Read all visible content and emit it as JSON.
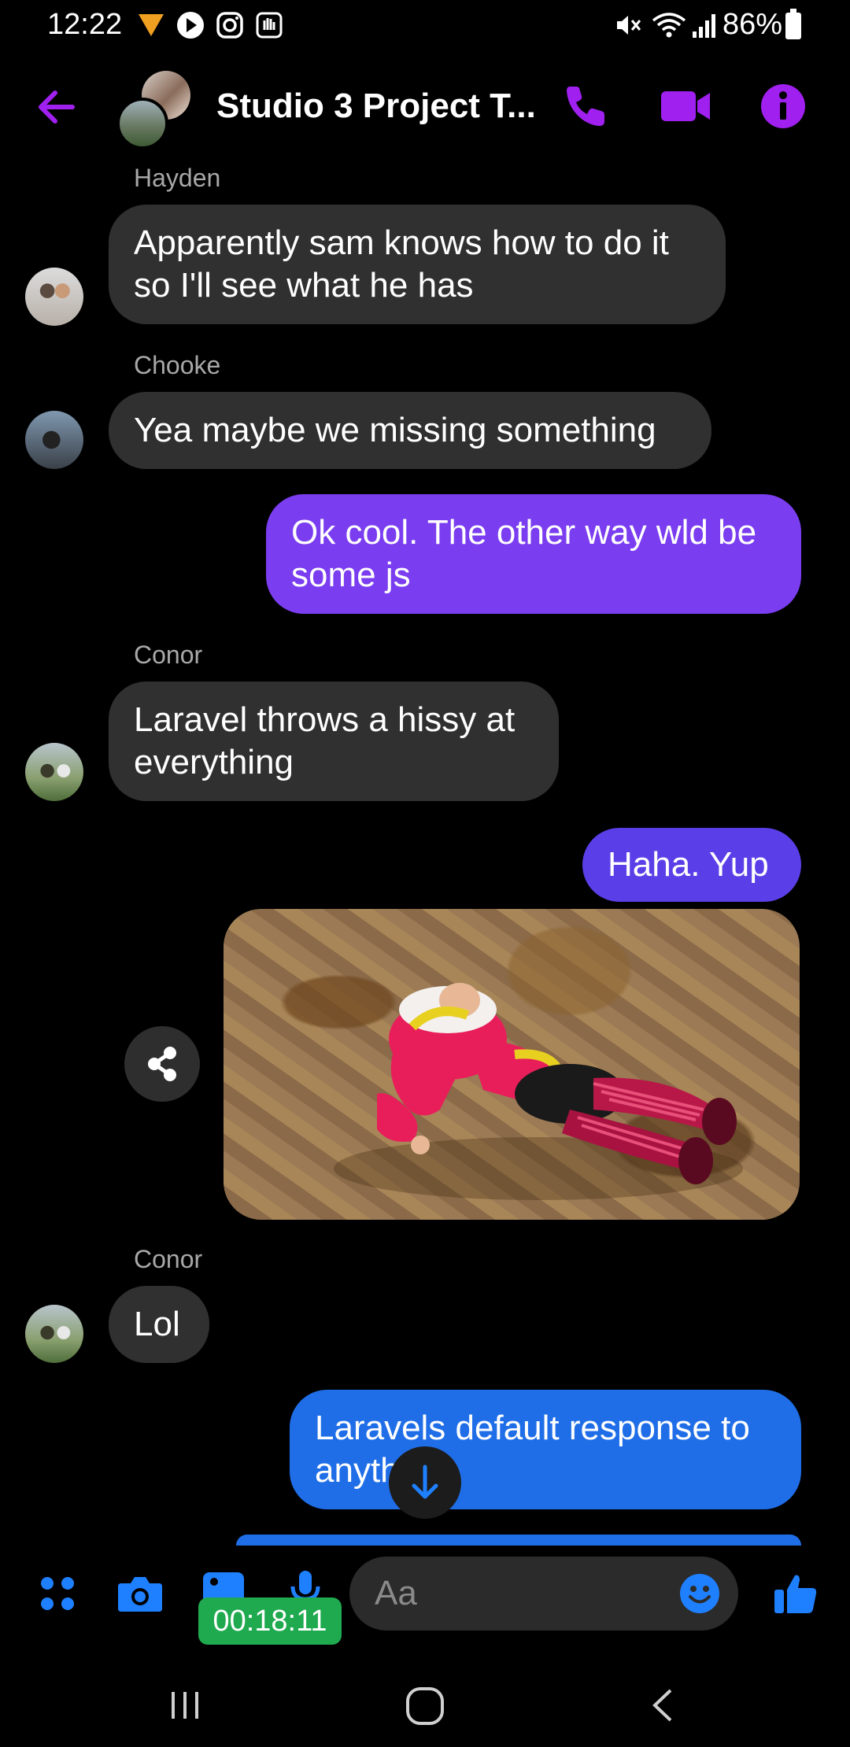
{
  "status_bar": {
    "time": "12:22",
    "battery": "86%"
  },
  "header": {
    "title": "Studio 3 Project T...",
    "accent": "#a020f0"
  },
  "messages": [
    {
      "sender": "Hayden",
      "text_lines": [
        "Apparently sam knows how to do it",
        "so I'll see what he has"
      ]
    },
    {
      "sender": "Chooke",
      "text_lines": [
        "Yea maybe we missing something"
      ]
    },
    {
      "sender": "me",
      "text_lines": [
        "Ok cool. The other way wld be",
        "some js"
      ]
    },
    {
      "sender": "Conor",
      "text_lines": [
        "Laravel throws a hissy at",
        "everything"
      ]
    },
    {
      "sender": "me",
      "text_lines": [
        "Haha. Yup"
      ]
    },
    {
      "sender": "me",
      "attachment": "gif"
    },
    {
      "sender": "Conor",
      "text_lines": [
        "Lol"
      ]
    },
    {
      "sender": "me",
      "text_lines": [
        "Laravels default response to",
        "anyth"
      ]
    }
  ],
  "composer": {
    "placeholder": "Aa",
    "timer": "00:18:11",
    "icons": [
      "apps-icon",
      "camera-icon",
      "gallery-icon",
      "mic-icon",
      "emoji-icon",
      "thumbs-up-icon"
    ],
    "accent": "#1f80ff"
  }
}
